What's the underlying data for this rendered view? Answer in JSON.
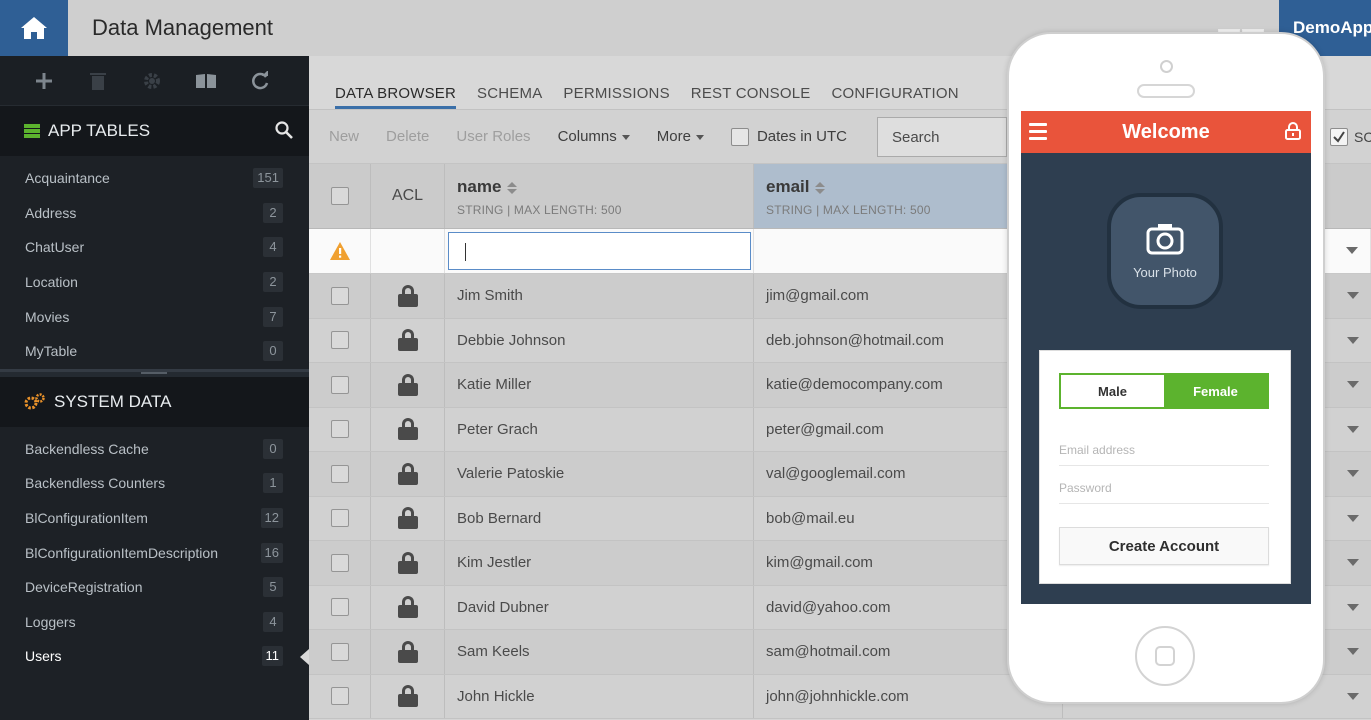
{
  "header": {
    "title": "Data Management",
    "app_name": "DemoApp"
  },
  "sidebar": {
    "app_tables_label": "APP TABLES",
    "app_tables": [
      {
        "name": "Acquaintance",
        "count": "151"
      },
      {
        "name": "Address",
        "count": "2"
      },
      {
        "name": "ChatUser",
        "count": "4"
      },
      {
        "name": "Location",
        "count": "2"
      },
      {
        "name": "Movies",
        "count": "7"
      },
      {
        "name": "MyTable",
        "count": "0"
      }
    ],
    "system_data_label": "SYSTEM DATA",
    "system_tables": [
      {
        "name": "Backendless Cache",
        "count": "0"
      },
      {
        "name": "Backendless Counters",
        "count": "1"
      },
      {
        "name": "BlConfigurationItem",
        "count": "12"
      },
      {
        "name": "BlConfigurationItemDescription",
        "count": "16"
      },
      {
        "name": "DeviceRegistration",
        "count": "5"
      },
      {
        "name": "Loggers",
        "count": "4"
      },
      {
        "name": "Users",
        "count": "11"
      }
    ]
  },
  "tabs": [
    "DATA BROWSER",
    "SCHEMA",
    "PERMISSIONS",
    "REST CONSOLE",
    "CONFIGURATION"
  ],
  "toolbar": {
    "new_label": "New",
    "delete_label": "Delete",
    "user_roles_label": "User Roles",
    "columns_label": "Columns",
    "more_label": "More",
    "dates_utc_label": "Dates in UTC",
    "search_placeholder": "Search",
    "right_check_label": "SC"
  },
  "grid": {
    "acl_header": "ACL",
    "columns": [
      {
        "name": "name",
        "meta": "STRING | MAX LENGTH: 500"
      },
      {
        "name": "email",
        "meta": "STRING | MAX LENGTH: 500"
      }
    ],
    "rows": [
      {
        "name": "Jim Smith",
        "email": "jim@gmail.com"
      },
      {
        "name": "Debbie Johnson",
        "email": "deb.johnson@hotmail.com"
      },
      {
        "name": "Katie Miller",
        "email": "katie@democompany.com"
      },
      {
        "name": "Peter Grach",
        "email": "peter@gmail.com"
      },
      {
        "name": "Valerie Patoskie",
        "email": "val@googlemail.com"
      },
      {
        "name": "Bob Bernard",
        "email": "bob@mail.eu"
      },
      {
        "name": "Kim Jestler",
        "email": "kim@gmail.com"
      },
      {
        "name": "David Dubner",
        "email": "david@yahoo.com"
      },
      {
        "name": "Sam Keels",
        "email": "sam@hotmail.com"
      },
      {
        "name": "John Hickle",
        "email": "john@johnhickle.com"
      }
    ]
  },
  "phone": {
    "title": "Welcome",
    "photo_label": "Your Photo",
    "male_label": "Male",
    "female_label": "Female",
    "email_placeholder": "Email address",
    "password_placeholder": "Password",
    "create_label": "Create Account"
  },
  "colors": {
    "accent_blue": "#2f5f95",
    "phone_header": "#e9543b",
    "phone_screen": "#2e3e50",
    "toggle_green": "#5cb32e",
    "warning": "#f0a030"
  }
}
